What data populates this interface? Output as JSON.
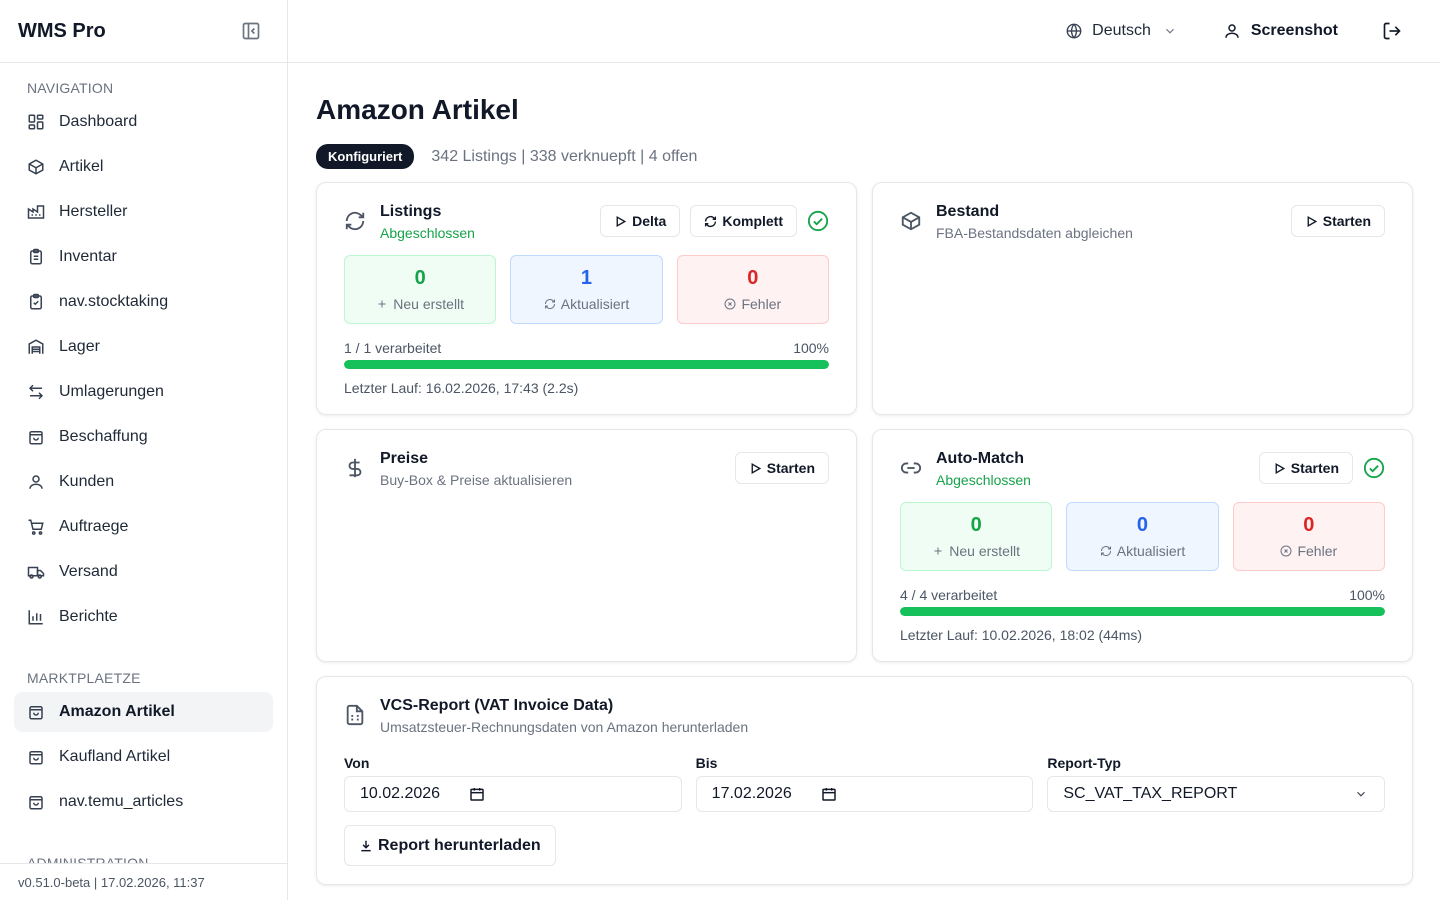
{
  "app": {
    "name": "WMS Pro",
    "version": "v0.51.0-beta | 17.02.2026, 11:37"
  },
  "topbar": {
    "language": "Deutsch",
    "user": "Screenshot"
  },
  "nav": {
    "section_nav": "NAVIGATION",
    "items": [
      {
        "label": "Dashboard",
        "icon": "dashboard-icon"
      },
      {
        "label": "Artikel",
        "icon": "package-icon"
      },
      {
        "label": "Hersteller",
        "icon": "factory-icon"
      },
      {
        "label": "Inventar",
        "icon": "clipboard-icon"
      },
      {
        "label": "nav.stocktaking",
        "icon": "clipboard-check-icon"
      },
      {
        "label": "Lager",
        "icon": "warehouse-icon"
      },
      {
        "label": "Umlagerungen",
        "icon": "arrows-left-right-icon"
      },
      {
        "label": "Beschaffung",
        "icon": "shopping-bag-icon"
      },
      {
        "label": "Kunden",
        "icon": "user-icon"
      },
      {
        "label": "Auftraege",
        "icon": "cart-icon"
      },
      {
        "label": "Versand",
        "icon": "truck-icon"
      },
      {
        "label": "Berichte",
        "icon": "bar-chart-icon"
      }
    ],
    "section_market": "MARKTPLAETZE",
    "market_items": [
      {
        "label": "Amazon Artikel",
        "icon": "shopping-bag-icon",
        "active": true
      },
      {
        "label": "Kaufland Artikel",
        "icon": "shopping-bag-icon"
      },
      {
        "label": "nav.temu_articles",
        "icon": "shopping-bag-icon"
      }
    ],
    "section_admin": "ADMINISTRATION"
  },
  "page": {
    "title": "Amazon Artikel",
    "badge": "Konfiguriert",
    "summary": "342 Listings | 338 verknuepft | 4 offen"
  },
  "listings": {
    "title": "Listings",
    "status": "Abgeschlossen",
    "btn_delta": "Delta",
    "btn_full": "Komplett",
    "created": "0",
    "created_label": "Neu erstellt",
    "updated": "1",
    "updated_label": "Aktualisiert",
    "errors": "0",
    "errors_label": "Fehler",
    "progress_text": "1 / 1 verarbeitet",
    "progress_pct": "100%",
    "progress": 1.0,
    "last_run": "Letzter Lauf: 16.02.2026, 17:43 (2.2s)"
  },
  "bestand": {
    "title": "Bestand",
    "subtitle": "FBA-Bestandsdaten abgleichen",
    "btn": "Starten"
  },
  "preise": {
    "title": "Preise",
    "subtitle": "Buy-Box & Preise aktualisieren",
    "btn": "Starten"
  },
  "automatch": {
    "title": "Auto-Match",
    "status": "Abgeschlossen",
    "btn": "Starten",
    "created": "0",
    "created_label": "Neu erstellt",
    "updated": "0",
    "updated_label": "Aktualisiert",
    "errors": "0",
    "errors_label": "Fehler",
    "progress_text": "4 / 4 verarbeitet",
    "progress_pct": "100%",
    "progress": 1.0,
    "last_run": "Letzter Lauf: 10.02.2026, 18:02 (44ms)"
  },
  "vcs": {
    "title": "VCS-Report (VAT Invoice Data)",
    "subtitle": "Umsatzsteuer-Rechnungsdaten von Amazon herunterladen",
    "from_label": "Von",
    "from_value": "10.02.2026",
    "to_label": "Bis",
    "to_value": "17.02.2026",
    "type_label": "Report-Typ",
    "type_value": "SC_VAT_TAX_REPORT",
    "download": "Report herunterladen"
  },
  "colors": {
    "success": "#16a34a",
    "info": "#2563eb",
    "danger": "#dc2626",
    "progress": "#16c05a",
    "badge": "#111827"
  }
}
